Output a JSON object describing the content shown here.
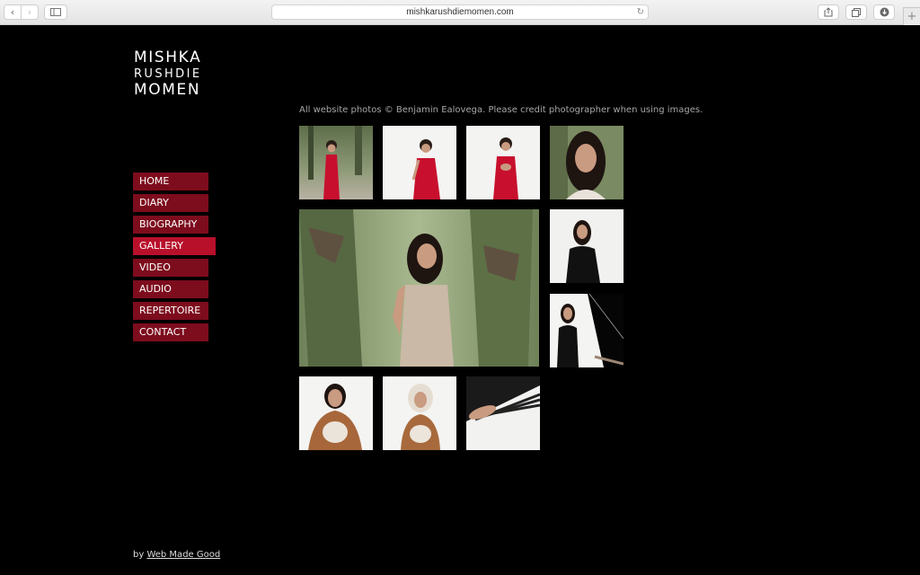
{
  "browser": {
    "url": "mishkarushdiemomen.com"
  },
  "logo": {
    "line1": "MISHKA",
    "line2": "RUSHDIE",
    "line3": "MOMEN"
  },
  "nav": {
    "items": [
      {
        "label": "HOME"
      },
      {
        "label": "DIARY"
      },
      {
        "label": "BIOGRAPHY"
      },
      {
        "label": "GALLERY",
        "active": true
      },
      {
        "label": "VIDEO"
      },
      {
        "label": "AUDIO"
      },
      {
        "label": "REPERTOIRE"
      },
      {
        "label": "CONTACT"
      }
    ]
  },
  "gallery": {
    "credit": "All website photos © Benjamin Ealovega. Please credit photographer when using images."
  },
  "footer": {
    "prefix": "by",
    "link": "Web Made Good"
  },
  "colors": {
    "nav_bg": "#7d0c1d",
    "nav_active": "#b8102b",
    "page_bg": "#000000"
  }
}
